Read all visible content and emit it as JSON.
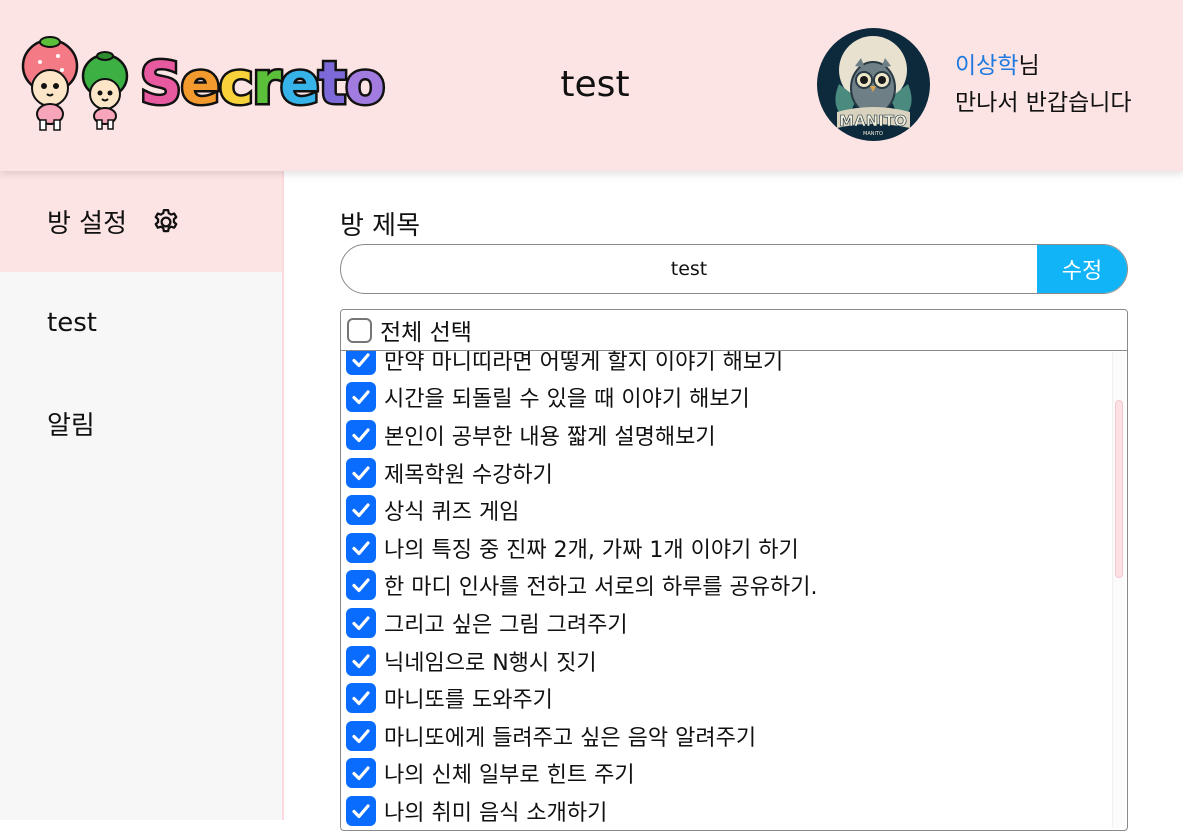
{
  "header": {
    "logo_text": "Secreto",
    "room_title": "test",
    "user_name": "이상학",
    "user_suffix": "님",
    "greeting": "만나서 반갑습니다",
    "avatar_caption": "MANITO"
  },
  "sidebar": {
    "items": [
      {
        "label": "방 설정",
        "icon": "gear-icon",
        "active": true
      },
      {
        "label": "test"
      },
      {
        "label": "알림"
      }
    ]
  },
  "main": {
    "title_label": "방 제목",
    "title_value": "test",
    "edit_button": "수정",
    "select_all_label": "전체 선택",
    "missions": [
      "만약 마니띠라면 어떻게 할지 이야기 해보기",
      "시간을 되돌릴 수 있을 때 이야기 해보기",
      "본인이 공부한 내용 짧게 설명해보기",
      "제목학원 수강하기",
      "상식 퀴즈 게임",
      "나의 특징 중 진짜 2개, 가짜 1개 이야기 하기",
      "한 마디 인사를 전하고 서로의 하루를 공유하기.",
      "그리고 싶은 그림 그려주기",
      "닉네임으로 N행시 짓기",
      "마니또를 도와주기",
      "마니또에게 들려주고 싶은 음악 알려주기",
      "나의 신체 일부로 힌트 주기",
      "나의 취미 음식 소개하기"
    ]
  },
  "colors": {
    "header_bg": "#fde4e4",
    "accent_blue": "#10b4f7",
    "checkbox_blue": "#0a6cff",
    "username_blue": "#1f7ae0"
  }
}
